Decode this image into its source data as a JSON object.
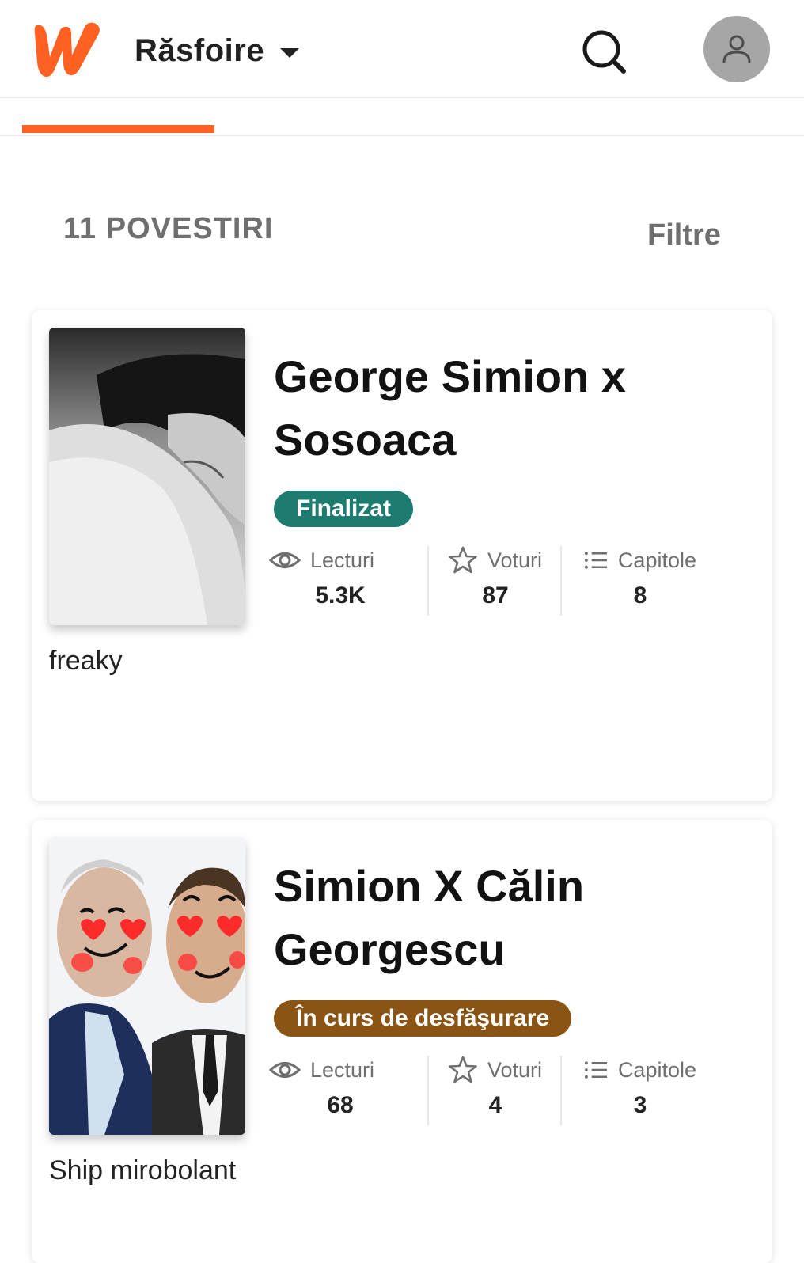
{
  "header": {
    "browse_label": "Răsfoire"
  },
  "results": {
    "count_label": "11 POVESTIRI",
    "filters_label": "Filtre"
  },
  "stat_labels": {
    "reads": "Lecturi",
    "votes": "Voturi",
    "chapters": "Capitole"
  },
  "colors": {
    "brand": "#ff6122",
    "completed_badge": "#1e7b6f",
    "ongoing_badge": "#8a5414"
  },
  "stories": [
    {
      "title": "George Simion x Sosoaca",
      "status": "Finalizat",
      "reads": "5.3K",
      "votes": "87",
      "chapters": "8",
      "description": "freaky"
    },
    {
      "title": "Simion X Călin Georgescu",
      "status": "În curs de desfăşurare",
      "reads": "68",
      "votes": "4",
      "chapters": "3",
      "description": "Ship mirobolant"
    }
  ]
}
